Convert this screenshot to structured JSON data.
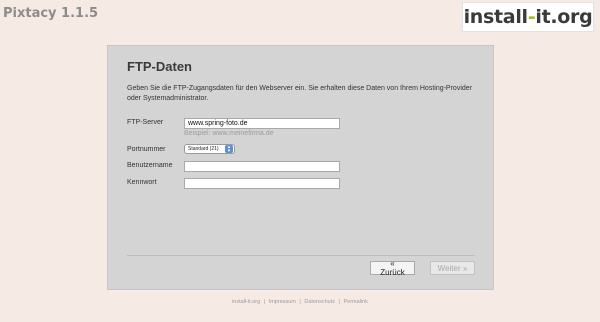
{
  "app": {
    "title": "Pixtacy 1.1.5"
  },
  "logo": {
    "part1": "install",
    "dash": "-",
    "part2": "it.org"
  },
  "form": {
    "heading": "FTP-Daten",
    "intro": "Geben Sie die FTP-Zugangsdaten für den Webserver ein. Sie erhalten diese Daten von Ihrem Hosting-Provider oder Systemadministrator.",
    "ftp_server": {
      "label": "FTP-Server",
      "value": "www.spring-foto.de",
      "hint": "Beispiel: www.meinefirma.de"
    },
    "port": {
      "label": "Portnummer",
      "selected": "Standard (21)"
    },
    "username": {
      "label": "Benutzername",
      "value": ""
    },
    "password": {
      "label": "Kennwort",
      "value": ""
    }
  },
  "buttons": {
    "back": "« Zurück",
    "next": "Weiter »"
  },
  "footer": {
    "links": [
      "install-it.org",
      "Impressum",
      "Datenschutz",
      "Permalink"
    ]
  }
}
